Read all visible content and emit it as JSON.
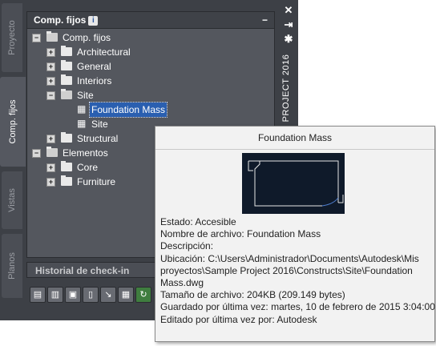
{
  "vertical_tabs": {
    "proyecto": "Proyecto",
    "comp_fijos": "Comp. fijos",
    "vistas": "Vistas",
    "planos": "Planos"
  },
  "panel": {
    "title": "Comp. fijos",
    "info_badge": "i",
    "collapse_symbol": "−"
  },
  "tree": {
    "root": "Comp. fijos",
    "architectural": "Architectural",
    "general": "General",
    "interiors": "Interiors",
    "site": "Site",
    "foundation_mass": "Foundation Mass",
    "site_child": "Site",
    "structural": "Structural",
    "elementos": "Elementos",
    "core": "Core",
    "furniture": "Furniture",
    "expand_symbol": "+",
    "collapse_symbol": "−"
  },
  "history_bar": "Historial de check-in",
  "palette_controls": {
    "close": "✕",
    "autohide": "⇥",
    "settings": "✱"
  },
  "palette_title": "PROJECT 2016",
  "tooltip": {
    "title": "Foundation Mass",
    "estado": "Estado: Accesible",
    "nombre": "Nombre de archivo: Foundation Mass",
    "descripcion": "Descripción:",
    "ubicacion_1": "Ubicación: C:\\Users\\Administrador\\Documents\\Autodesk\\Mis",
    "ubicacion_2": "proyectos\\Sample Project 2016\\Constructs\\Site\\Foundation",
    "ubicacion_3": "Mass.dwg",
    "tamano": "Tamaño de archivo: 204KB (209.149 bytes)",
    "guardado": "Guardado por última vez: martes, 10 de febrero de 2015  3:04:00",
    "editado": "Editado por última vez por: Autodesk"
  },
  "colors": {
    "palette_bg": "#3d4046",
    "panel_bg": "#54575e",
    "selection": "#2a5fb0",
    "tooltip_bg": "#f2f2f2",
    "preview_bg": "#0f1a2a"
  }
}
